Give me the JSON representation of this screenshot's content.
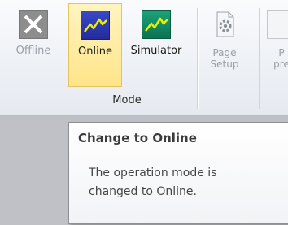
{
  "ribbon": {
    "group_label": "Mode",
    "buttons": {
      "offline": {
        "label": "Offline",
        "icon": "offline-x-icon",
        "disabled": true
      },
      "online": {
        "label": "Online",
        "icon": "online-waveform-icon",
        "active": true
      },
      "simulator": {
        "label": "Simulator",
        "icon": "simulator-waveform-icon"
      },
      "page_setup": {
        "label_line1": "Page",
        "label_line2": "Setup",
        "icon": "page-setup-gear-icon",
        "disabled": true
      },
      "print_preview": {
        "label_line1": "P",
        "label_line2": "pre",
        "icon": "print-preview-icon",
        "disabled": true
      }
    }
  },
  "tooltip": {
    "title": "Change to Online",
    "body_line1": "The operation mode is",
    "body_line2": "changed to Online."
  },
  "colors": {
    "online_highlight": "#ffe58a",
    "online_icon_bg": "#2a32aa",
    "simulator_icon_bg": "#118a63",
    "waveform": "#e8f000"
  }
}
